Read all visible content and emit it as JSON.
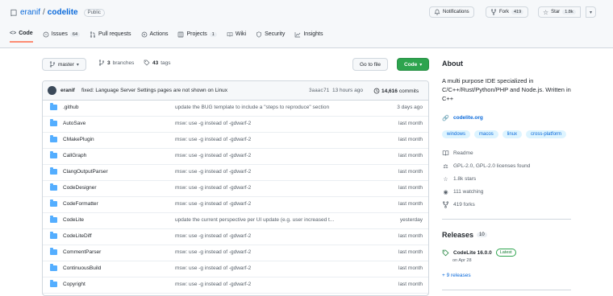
{
  "repo": {
    "owner": "eranif",
    "separator": "/",
    "name": "codelite",
    "visibility": "Public"
  },
  "header_actions": {
    "notifications": "Notifications",
    "fork": "Fork",
    "fork_count": "419",
    "star": "Star",
    "star_count": "1.8k"
  },
  "tabs": [
    {
      "label": "Code",
      "icon": "code-icon",
      "active": true
    },
    {
      "label": "Issues",
      "icon": "issue-icon",
      "count": "64"
    },
    {
      "label": "Pull requests",
      "icon": "pull-request-icon"
    },
    {
      "label": "Actions",
      "icon": "play-icon"
    },
    {
      "label": "Projects",
      "icon": "table-icon",
      "count": "1"
    },
    {
      "label": "Wiki",
      "icon": "book-icon"
    },
    {
      "label": "Security",
      "icon": "shield-icon"
    },
    {
      "label": "Insights",
      "icon": "graph-icon"
    }
  ],
  "toolbar": {
    "branch": "master",
    "branches_count": "3",
    "branches_label": "branches",
    "tags_count": "43",
    "tags_label": "tags",
    "go_to_file": "Go to file",
    "code_button": "Code"
  },
  "commit": {
    "author": "eranif",
    "message": "fixed: Language Server Settings pages are not shown on Linux",
    "hash": "3aaac71",
    "time": "13 hours ago",
    "count": "14,616",
    "count_label": "commits"
  },
  "files": [
    {
      "name": ".github",
      "message": "update the BUG template to include a \"steps to reproduce\" section",
      "time": "3 days ago"
    },
    {
      "name": "AutoSave",
      "message": "msw: use -g instead of -gdwarf-2",
      "time": "last month"
    },
    {
      "name": "CMakePlugin",
      "message": "msw: use -g instead of -gdwarf-2",
      "time": "last month"
    },
    {
      "name": "CallGraph",
      "message": "msw: use -g instead of -gdwarf-2",
      "time": "last month"
    },
    {
      "name": "ClangOutputParser",
      "message": "msw: use -g instead of -gdwarf-2",
      "time": "last month"
    },
    {
      "name": "CodeDesigner",
      "message": "msw: use -g instead of -gdwarf-2",
      "time": "last month"
    },
    {
      "name": "CodeFormatter",
      "message": "msw: use -g instead of -gdwarf-2",
      "time": "last month"
    },
    {
      "name": "CodeLite",
      "message": "update the current perspective per UI update (e.g. user increased t...",
      "time": "yesterday"
    },
    {
      "name": "CodeLiteDiff",
      "message": "msw: use -g instead of -gdwarf-2",
      "time": "last month"
    },
    {
      "name": "CommentParser",
      "message": "msw: use -g instead of -gdwarf-2",
      "time": "last month"
    },
    {
      "name": "ContinuousBuild",
      "message": "msw: use -g instead of -gdwarf-2",
      "time": "last month"
    },
    {
      "name": "Copyright",
      "message": "msw: use -g instead of -gdwarf-2",
      "time": "last month"
    }
  ],
  "about": {
    "heading": "About",
    "description": "A multi purpose IDE specialized in C/C++/Rust/Python/PHP and Node.js. Written in C++",
    "website": "codelite.org",
    "topics": [
      "windows",
      "macos",
      "linux",
      "cross-platform"
    ],
    "readme": "Readme",
    "license": "GPL-2.0, GPL-2.0 licenses found",
    "stars": "1.8k stars",
    "watching": "111 watching",
    "forks": "419 forks"
  },
  "releases": {
    "heading": "Releases",
    "count": "10",
    "latest_name": "CodeLite 16.0.0",
    "latest_badge": "Latest",
    "latest_date": "on Apr 28",
    "more": "+ 9 releases"
  },
  "colors": {
    "accent_link": "#0969da",
    "primary_green": "#2da44e",
    "folder": "#54aeff",
    "active_tab_underline": "#fd8c73"
  }
}
